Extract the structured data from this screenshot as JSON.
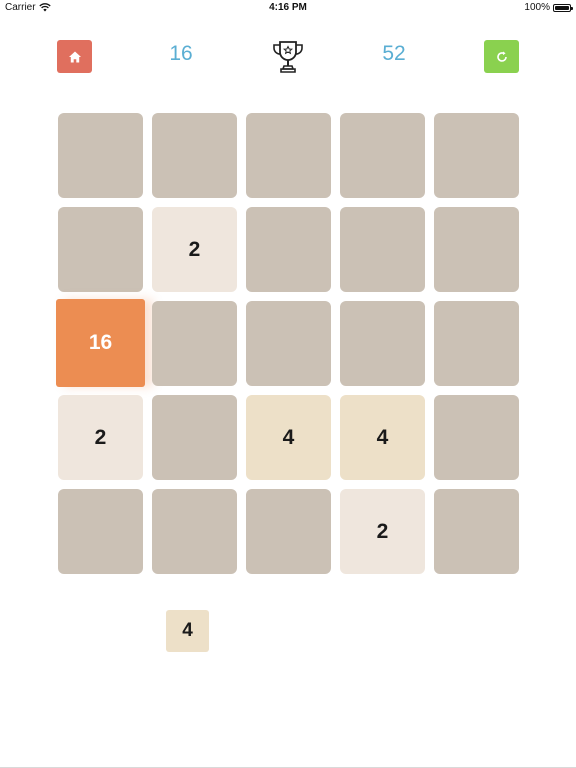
{
  "status_bar": {
    "carrier": "Carrier",
    "time": "4:16 PM",
    "battery": "100%"
  },
  "header": {
    "current_score": "16",
    "best_score": "52",
    "home_icon": "home-icon",
    "trophy_icon": "trophy-icon",
    "restart_icon": "restart-icon"
  },
  "colors": {
    "home_button": "#e06f5e",
    "restart_button": "#8ad14f",
    "score_text": "#5aaed3",
    "empty_cell": "#cbc1b5",
    "tile_2": "#efe6dd",
    "tile_4": "#ede0c8",
    "tile_16": "#ec8d52"
  },
  "board": {
    "rows": [
      [
        "",
        "",
        "",
        "",
        ""
      ],
      [
        "",
        "2",
        "",
        "",
        ""
      ],
      [
        "16",
        "",
        "",
        "",
        ""
      ],
      [
        "2",
        "",
        "4",
        "4",
        ""
      ],
      [
        "",
        "",
        "",
        "2",
        ""
      ]
    ]
  },
  "next_tile": {
    "value": "4"
  }
}
